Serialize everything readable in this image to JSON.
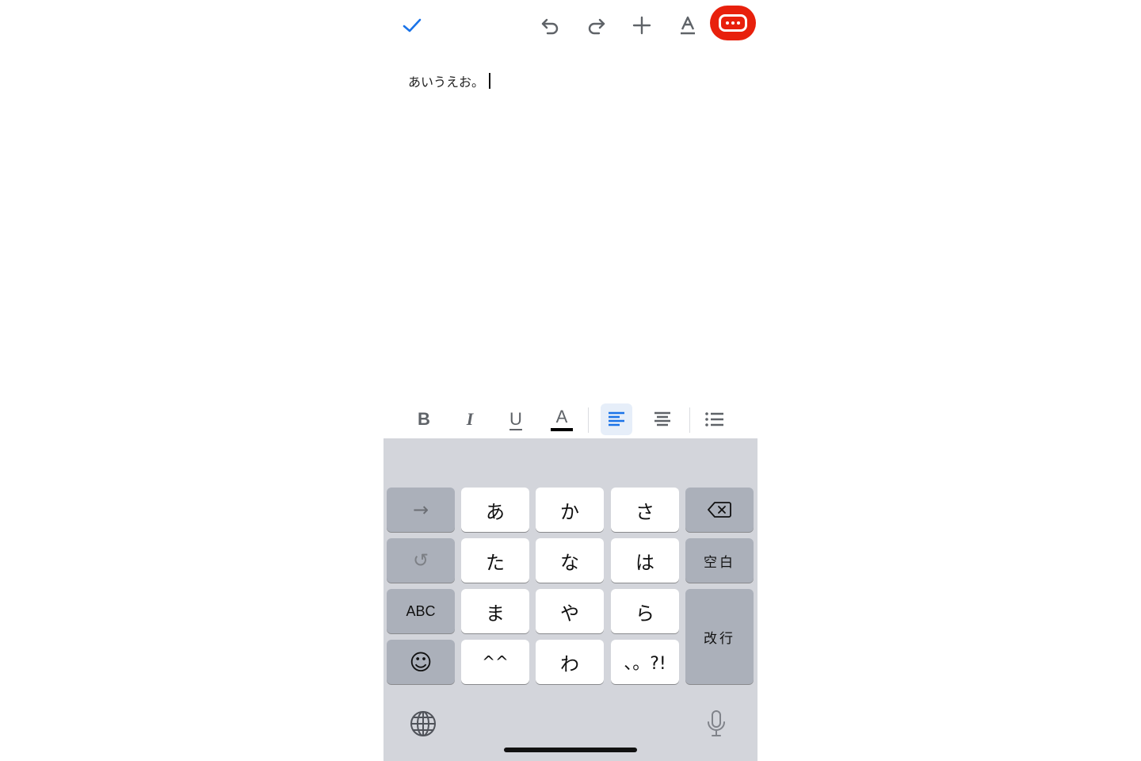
{
  "toolbar": {
    "done_icon": "check-icon",
    "undo_icon": "undo-icon",
    "redo_icon": "redo-icon",
    "insert_icon": "plus-icon",
    "text_format_icon": "text-format-icon",
    "more_icon": "more-options-icon",
    "accent_color": "#1a73e8",
    "highlight_color": "#e8200c"
  },
  "document": {
    "text": "あいうえお。"
  },
  "format_bar": {
    "bold_label": "B",
    "italic_label": "I",
    "underline_label": "U",
    "text_color_label": "A",
    "active_align": "left"
  },
  "keyboard": {
    "rows": [
      [
        "→",
        "あ",
        "か",
        "さ",
        "⌫"
      ],
      [
        "↺",
        "た",
        "な",
        "は",
        "空白"
      ],
      [
        "ABC",
        "ま",
        "や",
        "ら",
        "改行"
      ],
      [
        "☺",
        "^^",
        "わ",
        "、。?!"
      ]
    ],
    "arrow_key": "→",
    "undo_key": "↺",
    "abc_key": "ABC",
    "emoji_key": "☺",
    "space_key": "空白",
    "return_key": "改行",
    "keys": {
      "a": "あ",
      "ka": "か",
      "sa": "さ",
      "ta": "た",
      "na": "な",
      "ha": "は",
      "ma": "ま",
      "ya": "や",
      "ra": "ら",
      "kaomoji": "^^",
      "wa": "わ",
      "punct": "、。?!"
    }
  }
}
